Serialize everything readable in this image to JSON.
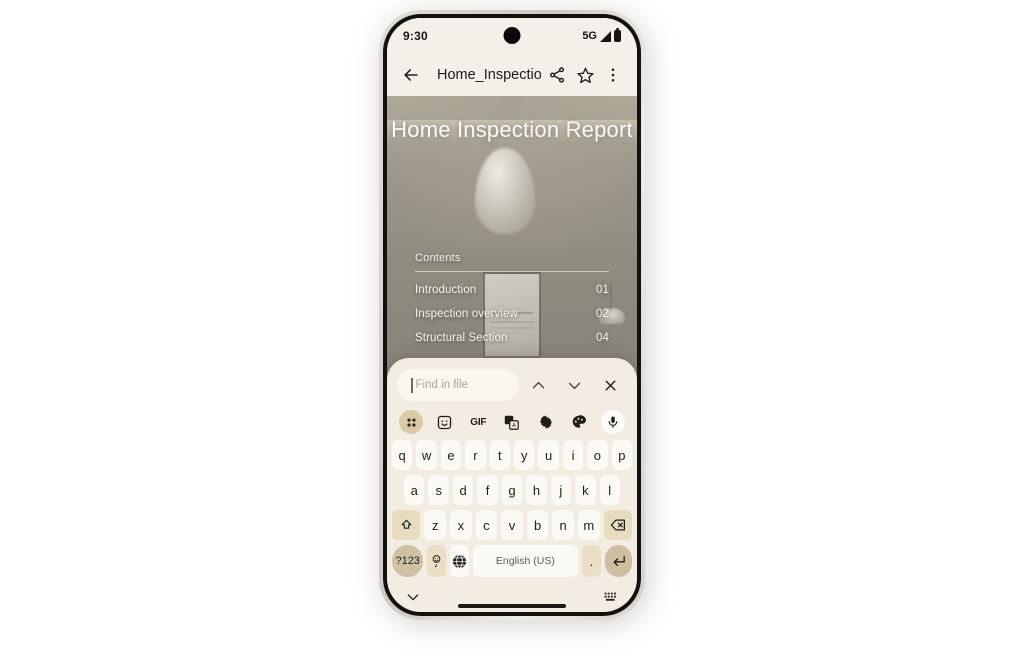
{
  "status_bar": {
    "time": "9:30",
    "network": "5G",
    "signal_icon": "signal-bars-icon",
    "battery_icon": "battery-icon",
    "camera_icon": "front-camera-punch-hole"
  },
  "app_toolbar": {
    "back_icon": "back-arrow-icon",
    "title": "Home_Inspection...",
    "share_icon": "share-icon",
    "star_icon": "star-outline-icon",
    "more_icon": "more-vertical-icon"
  },
  "document": {
    "title": "Home Inspection Report",
    "contents_label": "Contents",
    "toc": [
      {
        "label": "Introduction",
        "page": "01"
      },
      {
        "label": "Inspection overview",
        "page": "02"
      },
      {
        "label": "Structural Section",
        "page": "04"
      }
    ]
  },
  "find_bar": {
    "placeholder": "Find in file",
    "value": "",
    "prev_icon": "chevron-up-icon",
    "next_icon": "chevron-down-icon",
    "close_icon": "close-x-icon"
  },
  "keyboard_toolbar": [
    {
      "name": "grid-apps-icon",
      "label": "",
      "state": "active"
    },
    {
      "name": "sticker-face-icon",
      "label": ""
    },
    {
      "name": "gif-icon",
      "label": "GIF"
    },
    {
      "name": "translate-icon",
      "label": ""
    },
    {
      "name": "gear-settings-icon",
      "label": ""
    },
    {
      "name": "palette-theme-icon",
      "label": ""
    },
    {
      "name": "microphone-icon",
      "label": "",
      "state": "mic"
    }
  ],
  "keyboard": {
    "row1": [
      "q",
      "w",
      "e",
      "r",
      "t",
      "y",
      "u",
      "i",
      "o",
      "p"
    ],
    "row2": [
      "a",
      "s",
      "d",
      "f",
      "g",
      "h",
      "j",
      "k",
      "l"
    ],
    "row3": [
      "z",
      "x",
      "c",
      "v",
      "b",
      "n",
      "m"
    ],
    "shift_icon": "shift-up-arrow-icon",
    "backspace_icon": "backspace-delete-icon",
    "symbols_label": "?123",
    "emoji_icon": "emoji-comma-icon",
    "globe_icon": "language-globe-icon",
    "space_label": "English (US)",
    "period_label": ".",
    "enter_icon": "enter-return-icon"
  },
  "nav_bar": {
    "collapse_icon": "chevron-down-icon",
    "switch_keyboard_icon": "keyboard-switch-icon",
    "home_indicator": "home-gesture-bar"
  },
  "colors": {
    "frame": "#d9d3cb",
    "bezel": "#121110",
    "surface": "#f4efe9",
    "keyboard_bg": "#f3ece3",
    "key": "#fbf9f6",
    "key_accent": "#e8dcbf",
    "key_accent_dark": "#cfc2a2",
    "doc_overlay": "#8f8b7f",
    "text": "#201e18"
  }
}
